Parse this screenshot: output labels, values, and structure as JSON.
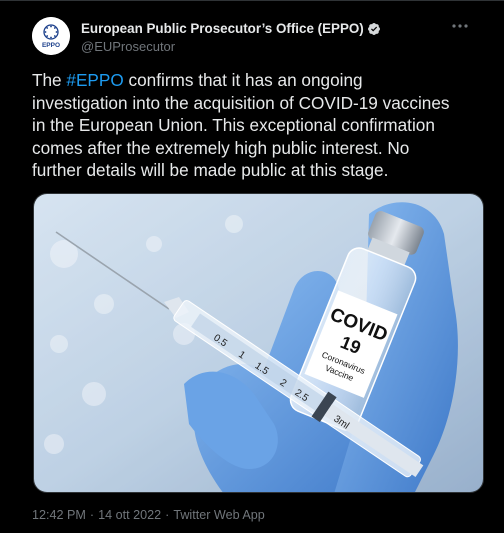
{
  "author": {
    "display_name": "European Public Prosecutor’s Office (EPPO)",
    "handle": "@EUProsecutor",
    "avatar_text": "EPPO",
    "verified_icon": "verified-badge-icon"
  },
  "tweet": {
    "lines": [
      {
        "before": "The ",
        "hashtag": "#EPPO",
        "after": " confirms that it has an ongoing"
      },
      {
        "text": "investigation into the acquisition of COVID-19 vaccines"
      },
      {
        "text": "in the European Union. This exceptional confirmation"
      },
      {
        "text": "comes after the extremely high public interest. No"
      },
      {
        "text": "further details will be made public at this stage."
      }
    ]
  },
  "media": {
    "vial_label_line1": "COVID",
    "vial_label_line2": "19",
    "vial_label_line3": "Coronavirus",
    "vial_label_line4": "Vaccine",
    "syringe_marks": [
      "0.5",
      "1",
      "1.5",
      "2",
      "2.5",
      "3ml"
    ]
  },
  "meta": {
    "time": "12:42 PM",
    "separator": "·",
    "date": "14 ott 2022",
    "source": "Twitter Web App"
  },
  "colors": {
    "background": "#000000",
    "text": "#e7e9ea",
    "secondary": "#71767b",
    "accent": "#1d9bf0",
    "glove": "#6fa6e8"
  }
}
